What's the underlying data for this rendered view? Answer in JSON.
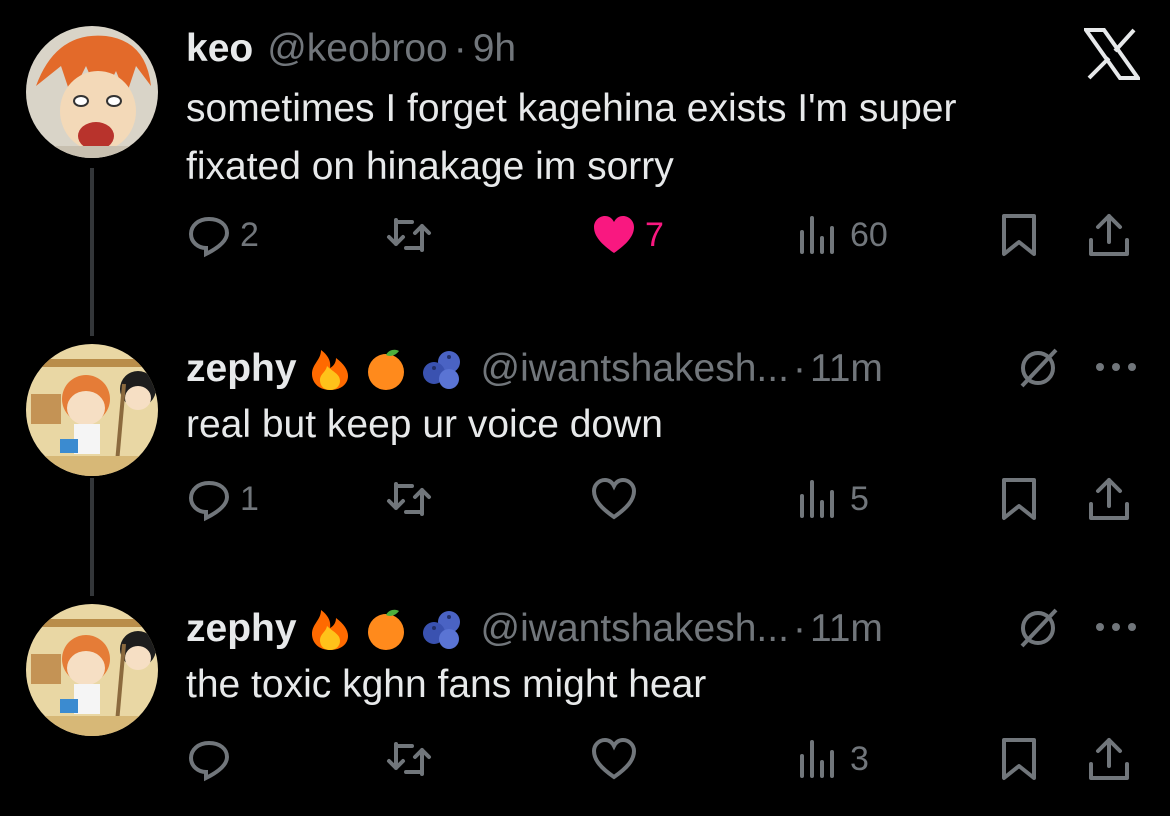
{
  "tweets": [
    {
      "name": "keo",
      "handle": "@keobroo",
      "separator": "·",
      "time": "9h",
      "text_lines": [
        "sometimes I forget kagehina exists I'm super",
        "fixated on hinakage im sorry"
      ],
      "replies": "2",
      "reposts": "",
      "likes": "7",
      "views": "60",
      "liked": true
    },
    {
      "name": "zephy",
      "handle": "@iwantshakesh...",
      "separator": "·",
      "time": "11m",
      "text_lines": [
        "real but keep ur voice down"
      ],
      "replies": "1",
      "reposts": "",
      "likes": "",
      "views": "5",
      "liked": false
    },
    {
      "name": "zephy",
      "handle": "@iwantshakesh...",
      "separator": "·",
      "time": "11m",
      "text_lines": [
        "the toxic kghn fans might hear"
      ],
      "replies": "",
      "reposts": "",
      "likes": "",
      "views": "3",
      "liked": false
    }
  ],
  "badges": [
    "fire-emoji",
    "orange-emoji",
    "blueberries-emoji"
  ],
  "colors": {
    "background": "#000000",
    "text": "#e7e9ea",
    "muted": "#71767b",
    "like": "#f91880"
  }
}
